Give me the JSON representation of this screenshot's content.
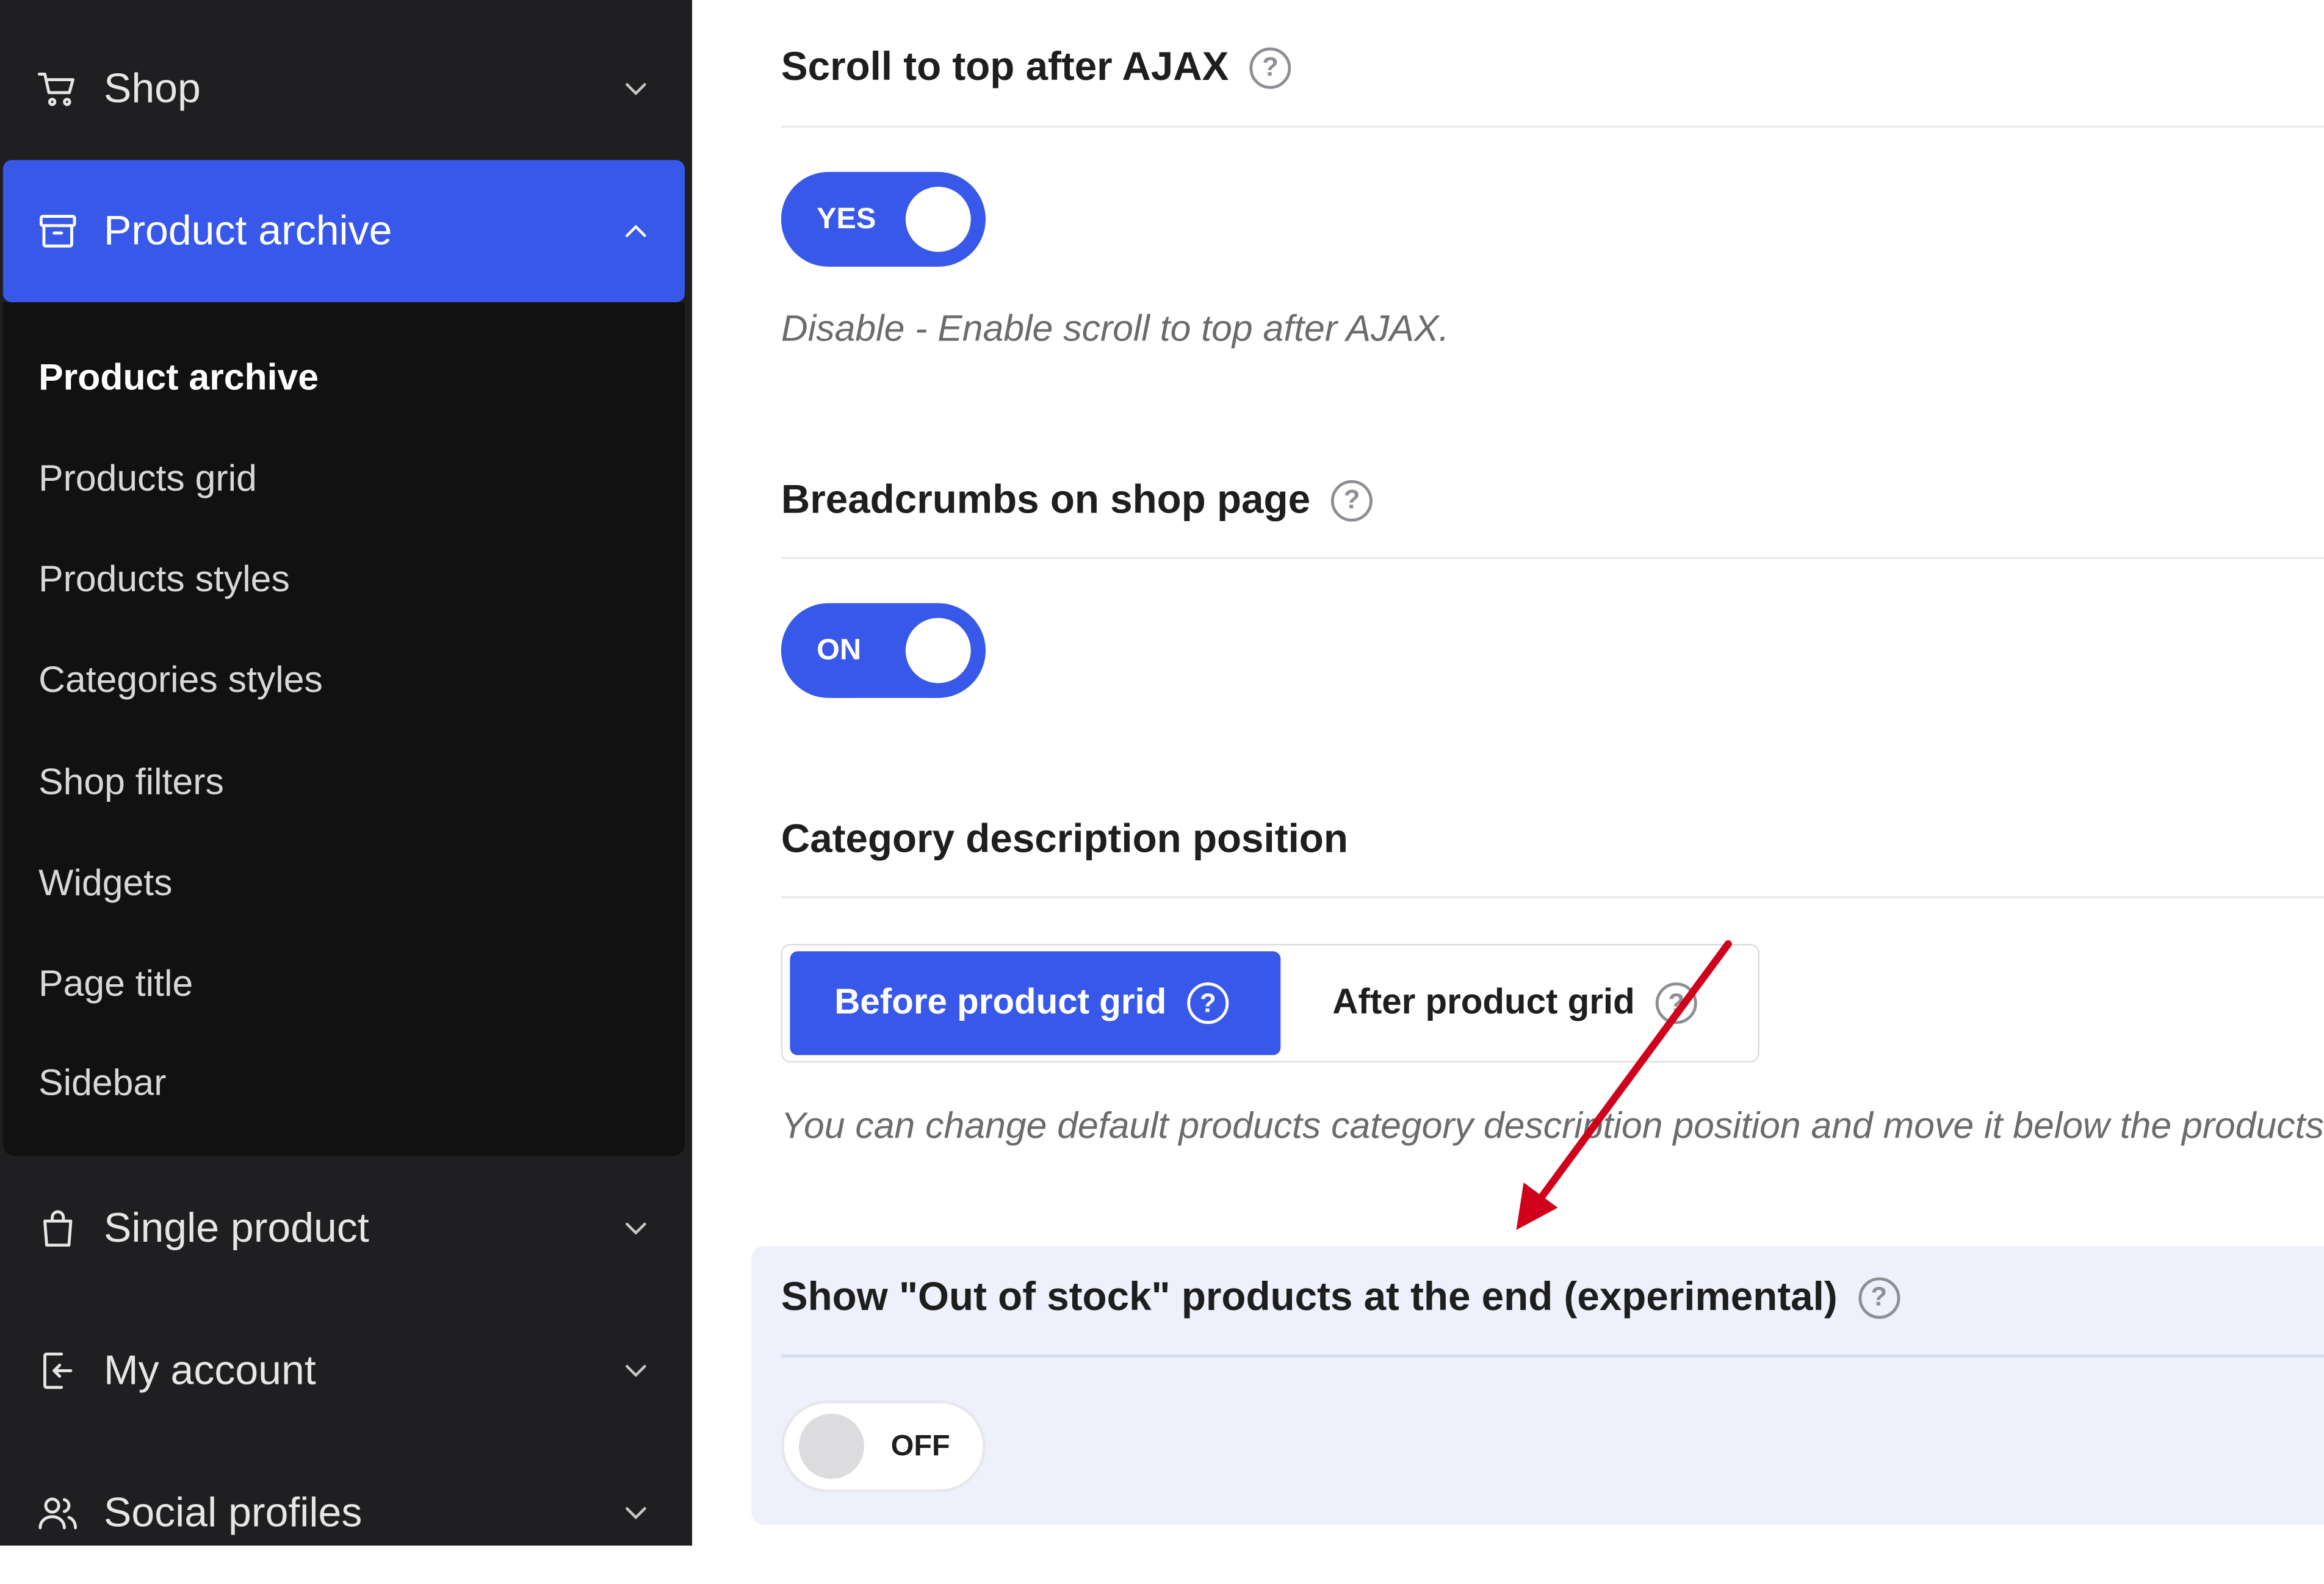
{
  "sidebar": {
    "items": [
      {
        "label": "Shop",
        "icon": "cart-icon"
      },
      {
        "label": "Product archive",
        "icon": "archive-icon",
        "active": true
      },
      {
        "label": "Single product",
        "icon": "shopping-bag-icon"
      },
      {
        "label": "My account",
        "icon": "login-icon"
      },
      {
        "label": "Social profiles",
        "icon": "users-icon"
      }
    ],
    "submenu": [
      {
        "label": "Product archive",
        "current": true
      },
      {
        "label": "Products grid"
      },
      {
        "label": "Products styles"
      },
      {
        "label": "Categories styles"
      },
      {
        "label": "Shop filters"
      },
      {
        "label": "Widgets"
      },
      {
        "label": "Page title"
      },
      {
        "label": "Sidebar"
      }
    ]
  },
  "settings": {
    "scroll_top": {
      "title": "Scroll to top after AJAX",
      "toggle_label": "YES",
      "description": "Disable - Enable scroll to top after AJAX."
    },
    "breadcrumbs": {
      "title": "Breadcrumbs on shop page",
      "toggle_label": "ON"
    },
    "category_desc": {
      "title": "Category description position",
      "options": [
        "Before product grid",
        "After product grid"
      ],
      "selected": "Before product grid",
      "description": "You can change default products category description position and move it below the products grid."
    },
    "out_of_stock": {
      "title": "Show \"Out of stock\" products at the end (experimental)",
      "toggle_label": "OFF"
    }
  },
  "colors": {
    "accent": "#3858e9",
    "sidebar_bg": "#1f1f21",
    "submenu_bg": "#111111",
    "highlight_bg": "#eef0fc",
    "annotation_arrow": "#d0021b"
  }
}
